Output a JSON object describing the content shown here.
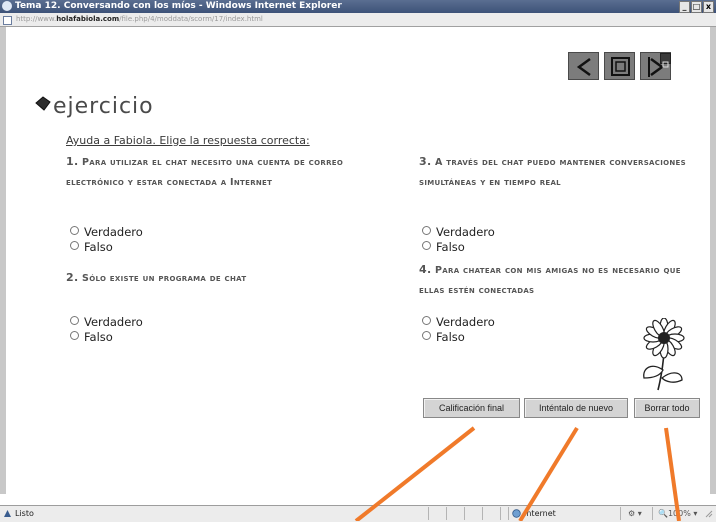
{
  "window": {
    "title": "Tema 12. Conversando con los míos - Windows Internet Explorer",
    "address_prefix": "http://www.",
    "address_domain": "holafabiola.com",
    "address_path": "/file.php/4/moddata/scorm/17/index.html",
    "min_label": "_",
    "max_label": "□",
    "close_label": "x"
  },
  "nav": {
    "icons": [
      "previous-icon",
      "home-icon",
      "next-icon",
      "help-icon"
    ]
  },
  "exercise": {
    "title": "ejercicio",
    "instruction": "Ayuda a Fabiola. Elige la respuesta correcta:",
    "questions": [
      {
        "number": "1.",
        "text": "Para utilizar el chat necesito una cuenta de correo electrónico y estar conectada a Internet",
        "options": [
          "Verdadero",
          "Falso"
        ]
      },
      {
        "number": "2.",
        "text": "Sólo existe un programa de chat",
        "options": [
          "Verdadero",
          "Falso"
        ]
      },
      {
        "number": "3.",
        "text": "A través del chat puedo mantener conversaciones simultáneas y en tiempo real",
        "options": [
          "Verdadero",
          "Falso"
        ]
      },
      {
        "number": "4.",
        "text": "Para chatear con mis amigas no es necesario que ellas estén conectadas",
        "options": [
          "Verdadero",
          "Falso"
        ]
      }
    ]
  },
  "buttons": {
    "final": "Calificación final",
    "retry": "Inténtalo de nuevo",
    "clear": "Borrar todo"
  },
  "status": {
    "left": "Listo",
    "zone": "Internet",
    "zoom": "100%"
  },
  "colors": {
    "annotation_arrow": "#f07a2a",
    "nav_button": "#7c7c7c"
  }
}
